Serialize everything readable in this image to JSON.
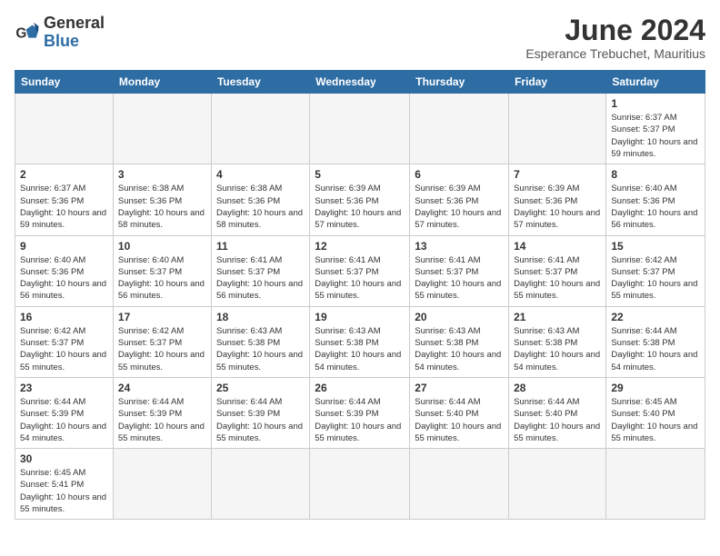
{
  "header": {
    "logo_general": "General",
    "logo_blue": "Blue",
    "month_title": "June 2024",
    "location": "Esperance Trebuchet, Mauritius"
  },
  "days_of_week": [
    "Sunday",
    "Monday",
    "Tuesday",
    "Wednesday",
    "Thursday",
    "Friday",
    "Saturday"
  ],
  "weeks": [
    [
      {
        "day": "",
        "info": ""
      },
      {
        "day": "",
        "info": ""
      },
      {
        "day": "",
        "info": ""
      },
      {
        "day": "",
        "info": ""
      },
      {
        "day": "",
        "info": ""
      },
      {
        "day": "",
        "info": ""
      },
      {
        "day": "1",
        "info": "Sunrise: 6:37 AM\nSunset: 5:37 PM\nDaylight: 10 hours and 59 minutes."
      }
    ],
    [
      {
        "day": "2",
        "info": "Sunrise: 6:37 AM\nSunset: 5:36 PM\nDaylight: 10 hours and 59 minutes."
      },
      {
        "day": "3",
        "info": "Sunrise: 6:38 AM\nSunset: 5:36 PM\nDaylight: 10 hours and 58 minutes."
      },
      {
        "day": "4",
        "info": "Sunrise: 6:38 AM\nSunset: 5:36 PM\nDaylight: 10 hours and 58 minutes."
      },
      {
        "day": "5",
        "info": "Sunrise: 6:39 AM\nSunset: 5:36 PM\nDaylight: 10 hours and 57 minutes."
      },
      {
        "day": "6",
        "info": "Sunrise: 6:39 AM\nSunset: 5:36 PM\nDaylight: 10 hours and 57 minutes."
      },
      {
        "day": "7",
        "info": "Sunrise: 6:39 AM\nSunset: 5:36 PM\nDaylight: 10 hours and 57 minutes."
      },
      {
        "day": "8",
        "info": "Sunrise: 6:40 AM\nSunset: 5:36 PM\nDaylight: 10 hours and 56 minutes."
      }
    ],
    [
      {
        "day": "9",
        "info": "Sunrise: 6:40 AM\nSunset: 5:36 PM\nDaylight: 10 hours and 56 minutes."
      },
      {
        "day": "10",
        "info": "Sunrise: 6:40 AM\nSunset: 5:37 PM\nDaylight: 10 hours and 56 minutes."
      },
      {
        "day": "11",
        "info": "Sunrise: 6:41 AM\nSunset: 5:37 PM\nDaylight: 10 hours and 56 minutes."
      },
      {
        "day": "12",
        "info": "Sunrise: 6:41 AM\nSunset: 5:37 PM\nDaylight: 10 hours and 55 minutes."
      },
      {
        "day": "13",
        "info": "Sunrise: 6:41 AM\nSunset: 5:37 PM\nDaylight: 10 hours and 55 minutes."
      },
      {
        "day": "14",
        "info": "Sunrise: 6:41 AM\nSunset: 5:37 PM\nDaylight: 10 hours and 55 minutes."
      },
      {
        "day": "15",
        "info": "Sunrise: 6:42 AM\nSunset: 5:37 PM\nDaylight: 10 hours and 55 minutes."
      }
    ],
    [
      {
        "day": "16",
        "info": "Sunrise: 6:42 AM\nSunset: 5:37 PM\nDaylight: 10 hours and 55 minutes."
      },
      {
        "day": "17",
        "info": "Sunrise: 6:42 AM\nSunset: 5:37 PM\nDaylight: 10 hours and 55 minutes."
      },
      {
        "day": "18",
        "info": "Sunrise: 6:43 AM\nSunset: 5:38 PM\nDaylight: 10 hours and 55 minutes."
      },
      {
        "day": "19",
        "info": "Sunrise: 6:43 AM\nSunset: 5:38 PM\nDaylight: 10 hours and 54 minutes."
      },
      {
        "day": "20",
        "info": "Sunrise: 6:43 AM\nSunset: 5:38 PM\nDaylight: 10 hours and 54 minutes."
      },
      {
        "day": "21",
        "info": "Sunrise: 6:43 AM\nSunset: 5:38 PM\nDaylight: 10 hours and 54 minutes."
      },
      {
        "day": "22",
        "info": "Sunrise: 6:44 AM\nSunset: 5:38 PM\nDaylight: 10 hours and 54 minutes."
      }
    ],
    [
      {
        "day": "23",
        "info": "Sunrise: 6:44 AM\nSunset: 5:39 PM\nDaylight: 10 hours and 54 minutes."
      },
      {
        "day": "24",
        "info": "Sunrise: 6:44 AM\nSunset: 5:39 PM\nDaylight: 10 hours and 55 minutes."
      },
      {
        "day": "25",
        "info": "Sunrise: 6:44 AM\nSunset: 5:39 PM\nDaylight: 10 hours and 55 minutes."
      },
      {
        "day": "26",
        "info": "Sunrise: 6:44 AM\nSunset: 5:39 PM\nDaylight: 10 hours and 55 minutes."
      },
      {
        "day": "27",
        "info": "Sunrise: 6:44 AM\nSunset: 5:40 PM\nDaylight: 10 hours and 55 minutes."
      },
      {
        "day": "28",
        "info": "Sunrise: 6:44 AM\nSunset: 5:40 PM\nDaylight: 10 hours and 55 minutes."
      },
      {
        "day": "29",
        "info": "Sunrise: 6:45 AM\nSunset: 5:40 PM\nDaylight: 10 hours and 55 minutes."
      }
    ],
    [
      {
        "day": "30",
        "info": "Sunrise: 6:45 AM\nSunset: 5:41 PM\nDaylight: 10 hours and 55 minutes."
      },
      {
        "day": "",
        "info": ""
      },
      {
        "day": "",
        "info": ""
      },
      {
        "day": "",
        "info": ""
      },
      {
        "day": "",
        "info": ""
      },
      {
        "day": "",
        "info": ""
      },
      {
        "day": "",
        "info": ""
      }
    ]
  ]
}
